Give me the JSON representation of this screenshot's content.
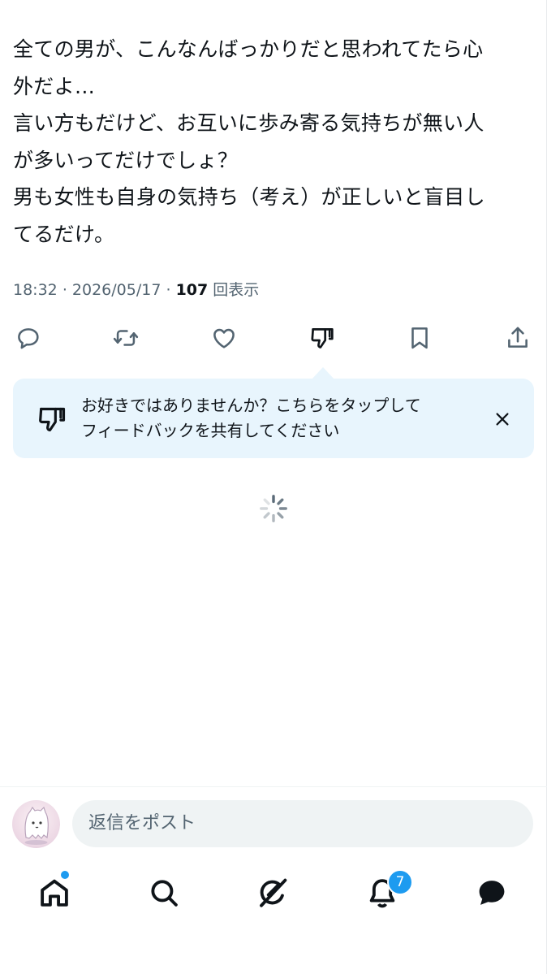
{
  "tweet": {
    "lines": [
      "全ての男が、こんなんばっかりだと思われてたら心",
      "外だよ…",
      "言い方もだけど、お互いに歩み寄る気持ちが無い人",
      "が多いってだけでしょ？",
      "男も女性も自身の気持ち（考え）が正しいと盲目し",
      "てるだけ。"
    ],
    "time": "18:32",
    "date": "2026/05/17",
    "views_count": "107",
    "views_label": "回表示"
  },
  "actions": {
    "icons": [
      "reply-icon",
      "retweet-icon",
      "like-icon",
      "dislike-icon",
      "bookmark-icon",
      "share-icon"
    ]
  },
  "tooltip": {
    "line1": "お好きではありませんか？こちらをタップして",
    "line2": "フィードバックを共有してください",
    "close_icon": "close-icon"
  },
  "reply": {
    "placeholder": "返信をポスト"
  },
  "nav": {
    "items": [
      "home-icon",
      "search-icon",
      "grok-icon",
      "notifications-icon",
      "messages-icon"
    ],
    "notifications_badge": "7"
  },
  "colors": {
    "accent": "#1d9bf0",
    "text": "#0f1419",
    "secondary": "#536471",
    "tooltip_bg": "#e8f5fd",
    "input_bg": "#eff3f4"
  }
}
